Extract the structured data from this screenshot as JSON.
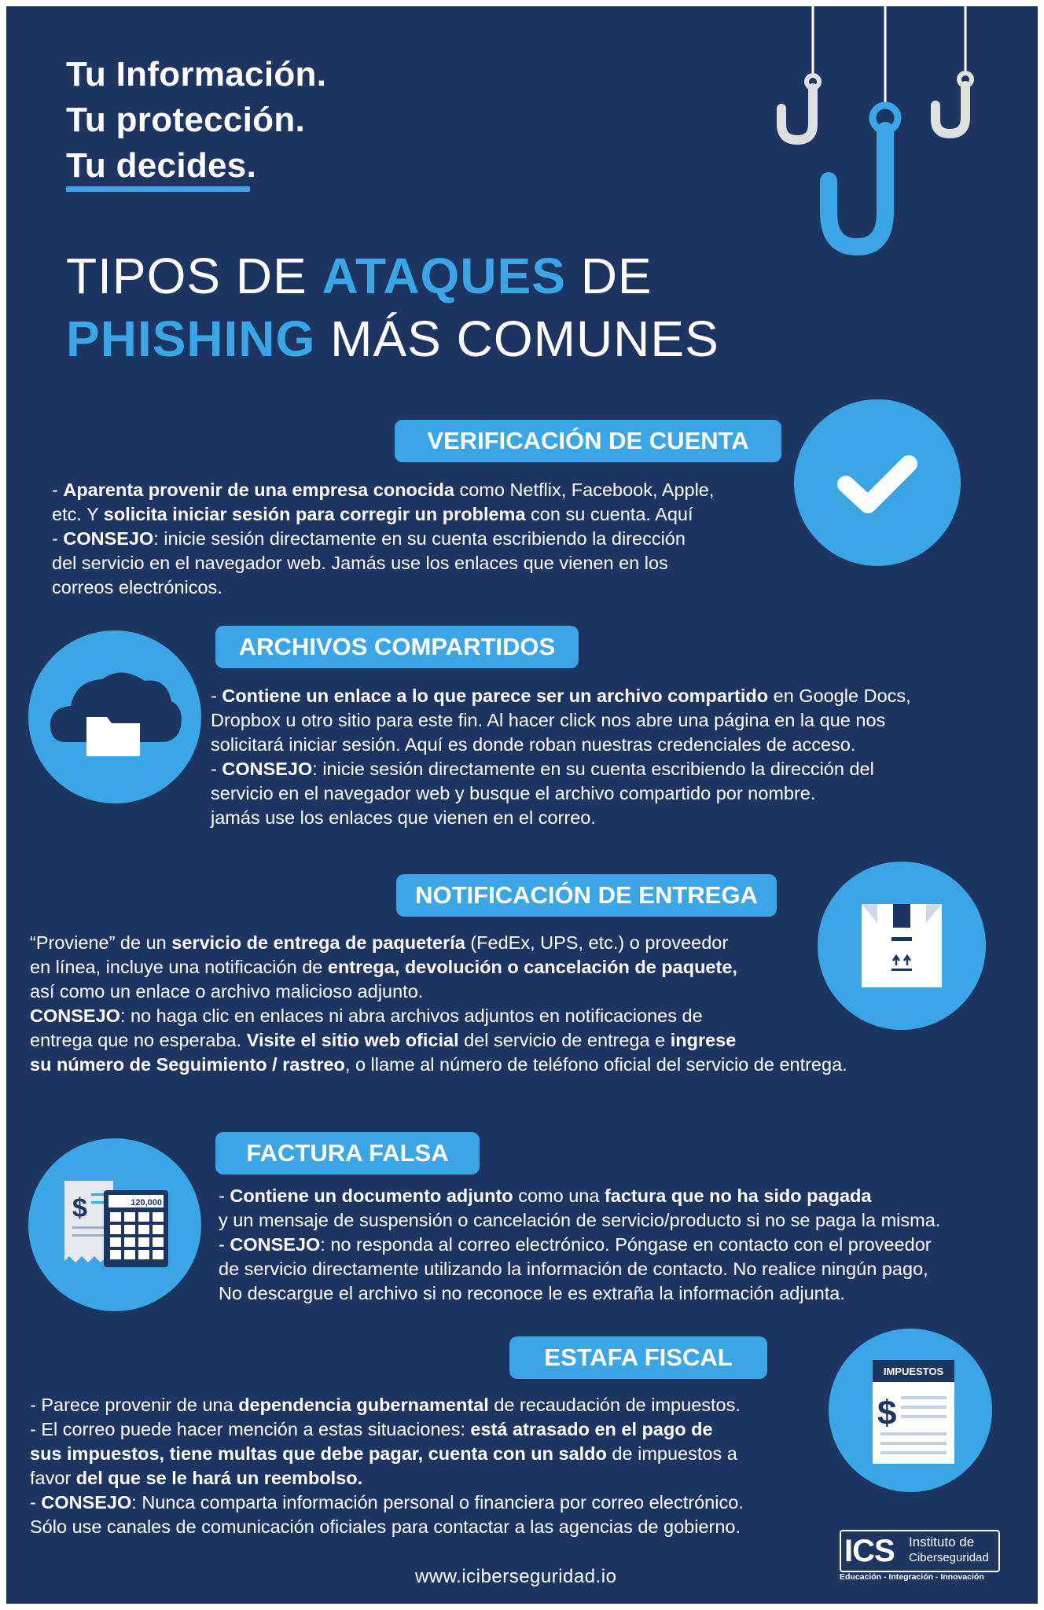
{
  "tagline": [
    "Tu Información.",
    "Tu protección.",
    "Tu decides."
  ],
  "headline": {
    "line1": {
      "pre": "TIPOS DE ",
      "highlight": "ATAQUES",
      "post": " DE"
    },
    "line2": {
      "highlight": "PHISHING",
      "post": " MÁS COMUNES"
    }
  },
  "colors": {
    "background": "#1d3561",
    "accent": "#3aa6e6",
    "text": "#ffffff"
  },
  "sections": {
    "s1": {
      "title": "VERIFICACIÓN DE CUENTA",
      "icon": "check-icon",
      "l1": {
        "a": "- ",
        "b": "Aparenta provenir de una empresa conocida",
        "c": " como Netflix, Facebook, Apple,"
      },
      "l2": {
        "a": "etc. Y ",
        "b": "solicita iniciar sesión para corregir un problema",
        "c": " con su cuenta. Aquí"
      },
      "l3": {
        "a": "- ",
        "b": "CONSEJO",
        "c": ": inicie sesión directamente en su cuenta escribiendo la dirección"
      },
      "l4": "del servicio en el  navegador web. Jamás use los enlaces que vienen en los",
      "l5": "correos electrónicos."
    },
    "s2": {
      "title": "ARCHIVOS COMPARTIDOS",
      "icon": "cloud-folder-icon",
      "l1": {
        "a": "- ",
        "b": "Contiene un enlace a lo que parece ser un archivo compartido",
        "c": " en Google Docs,"
      },
      "l2": "Dropbox u otro sitio para este fin.  Al hacer click nos abre una página en la que nos",
      "l3": "solicitará iniciar sesión. Aquí es donde roban nuestras credenciales de acceso.",
      "l4": {
        "a": "- ",
        "b": "CONSEJO",
        "c": ": inicie sesión directamente en su cuenta escribiendo la dirección del"
      },
      "l5": "servicio en el  navegador web y busque el archivo compartido por nombre.",
      "l6": "jamás use los enlaces que vienen en el correo."
    },
    "s3": {
      "title": "NOTIFICACIÓN DE ENTREGA",
      "icon": "package-icon",
      "l1": {
        "a": "“Proviene” de un ",
        "b": "servicio de entrega de paquetería",
        "c": " (FedEx, UPS, etc.) o proveedor"
      },
      "l2": {
        "a": "en línea, incluye una notificación de ",
        "b": "entrega, devolución o cancelación de paquete,"
      },
      "l3": "así como un enlace o archivo malicioso adjunto.",
      "l4": {
        "b": "CONSEJO",
        "c": ": no haga clic en enlaces ni abra archivos adjuntos en notificaciones de"
      },
      "l5": {
        "a": "entrega que no esperaba. ",
        "b": "Visite el sitio web oficial",
        "c": " del servicio de entrega e ",
        "d": "ingrese"
      },
      "l6": {
        "b": "su número de Seguimiento / rastreo",
        "c": ", o llame al número de teléfono oficial del servicio de entrega."
      }
    },
    "s4": {
      "title": "FACTURA FALSA",
      "icon": "invoice-calculator-icon",
      "calc_display": "120,000",
      "l1": {
        "a": "- ",
        "b": "Contiene un documento adjunto",
        "c": " como una ",
        "d": "factura que no ha sido pagada"
      },
      "l2": "y un mensaje de suspensión o cancelación de servicio/producto si no se paga la misma.",
      "l3": {
        "a": "- ",
        "b": "CONSEJO",
        "c": ": no responda al correo electrónico. Póngase en contacto con el proveedor"
      },
      "l4": "de servicio directamente utilizando la información de contacto. No realice ningún pago,",
      "l5": "No descargue el archivo si no reconoce le es extraña la información adjunta."
    },
    "s5": {
      "title": "ESTAFA FISCAL",
      "icon": "tax-document-icon",
      "doc_label": "IMPUESTOS",
      "l1": {
        "a": "- Parece provenir de una ",
        "b": "dependencia gubernamental",
        "c": " de recaudación de impuestos."
      },
      "l2": {
        "a": "- El correo puede hacer mención a estas situaciones:  ",
        "b": "está atrasado en el pago de"
      },
      "l3": {
        "b": "sus impuestos, tiene multas que debe pagar, cuenta con un saldo",
        "c": " de impuestos a"
      },
      "l4": {
        "a": "favor ",
        "b": "del que se le hará un reembolso."
      },
      "l5": {
        "a": "- ",
        "b": "CONSEJO",
        "c": ": Nunca comparta información personal o financiera por correo electrónico."
      },
      "l6": "Sólo use canales de comunicación oficiales para contactar a las agencias de gobierno."
    }
  },
  "footer": {
    "url": "www.iciberseguridad.io",
    "logo_abbr": "ICS",
    "logo_name_1": "Instituto de",
    "logo_name_2": "Ciberseguridad",
    "logo_tagline": "Educación - Integración - Innovación"
  }
}
